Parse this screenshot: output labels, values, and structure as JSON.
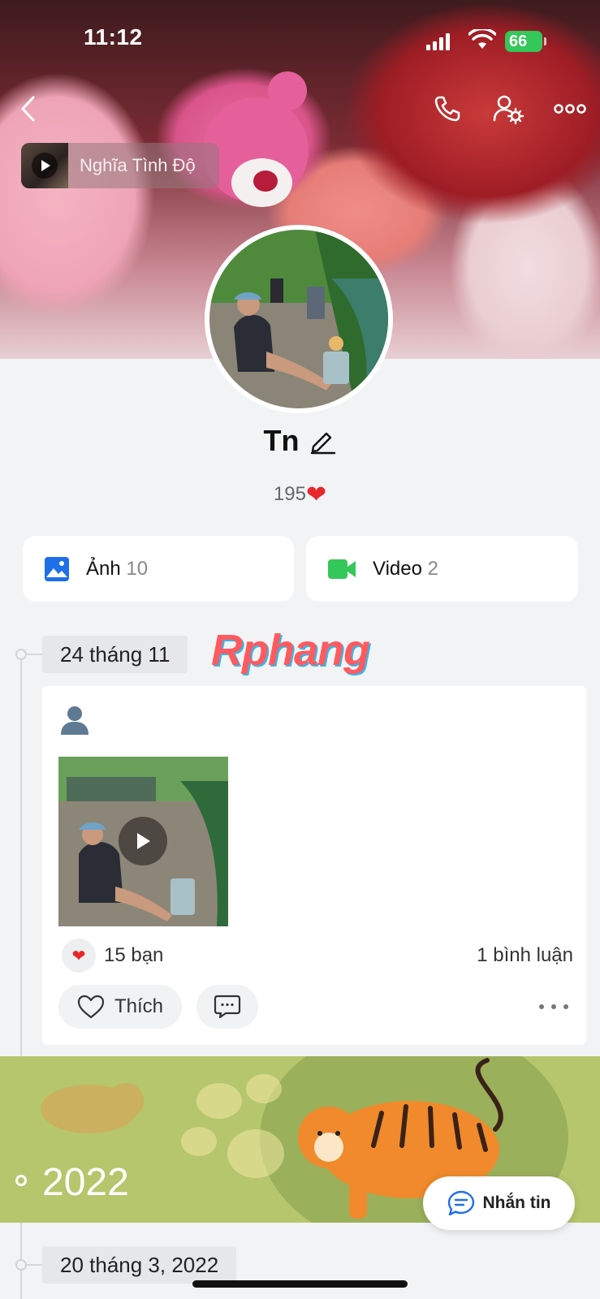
{
  "status_bar": {
    "time": "11:12",
    "battery": "66"
  },
  "header": {
    "back_icon": "chevron-left-icon",
    "call_icon": "phone-icon",
    "settings_icon": "user-gear-icon",
    "more_icon": "more-dots-icon"
  },
  "music": {
    "title": "Nghĩa Tình Độ"
  },
  "profile": {
    "name": "Tn",
    "likes_count": "195"
  },
  "media": {
    "photos": {
      "label": "Ảnh",
      "count": "10"
    },
    "videos": {
      "label": "Video",
      "count": "2"
    }
  },
  "watermark": "Rphang",
  "timeline": {
    "entries": [
      {
        "date": "24 tháng 11",
        "reactions": "15 bạn",
        "comments": "1 bình luận",
        "like_label": "Thích"
      }
    ],
    "year": "2022",
    "next_date": "20 tháng 3, 2022"
  },
  "message_button": {
    "label": "Nhắn tin"
  },
  "colors": {
    "accent_blue": "#1f6fe8",
    "video_green": "#34c759",
    "heart_red": "#e8262b",
    "banner_green": "#b6c66d"
  }
}
